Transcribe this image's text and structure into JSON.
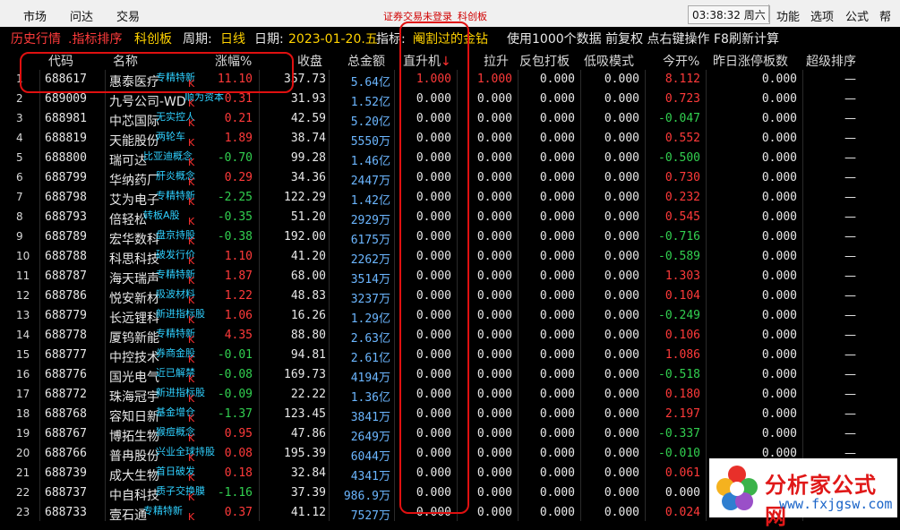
{
  "menubar": {
    "items": [
      "市场",
      "问达",
      "交易"
    ],
    "status_text": "证券交易未登录",
    "status_board": "科创板",
    "time": "03:38:32 周六",
    "right_items": [
      "功能",
      "选项",
      "公式",
      "帮助"
    ]
  },
  "titlebar": {
    "history": "历史行情",
    "ranking": ".指标排序",
    "board": "科创板",
    "period_label": "周期:",
    "period": "日线",
    "date_label": "日期:",
    "date": "2023-01-20.五",
    "indicator_label": "指标:",
    "indicator": "阉割过的金钻",
    "hint": "使用1000个数据 前复权 点右键操作 F8刷新计算"
  },
  "headers": {
    "code": "代码",
    "name": "名称",
    "zf": "涨幅%",
    "sp": "收盘",
    "zje": "总金额",
    "zsj": "直升机",
    "arrow": "↓",
    "ls": "拉升",
    "fbdb": "反包打板",
    "dxms": "低吸模式",
    "jk": "今开%",
    "zrztbs": "昨日涨停板数",
    "cjpx": "超级排序"
  },
  "rows": [
    {
      "idx": "1",
      "code": "688617",
      "name": "惠泰医疗",
      "tag": "专精特新",
      "zf": "11.10",
      "zfc": "red",
      "sp": "357.73",
      "zje": "5.64亿",
      "zsj": "1.000",
      "zsjc": "red",
      "ls": "1.000",
      "lsc": "red",
      "fbdb": "0.000",
      "dxms": "0.000",
      "jk": "8.112",
      "jkc": "red",
      "zr": "0.000",
      "cj": "—"
    },
    {
      "idx": "2",
      "code": "689009",
      "name": "九号公司-WD",
      "tag": "顺为资本",
      "zf": "0.31",
      "zfc": "red",
      "sp": "31.93",
      "zje": "1.52亿",
      "zsj": "0.000",
      "zsjc": "white",
      "ls": "0.000",
      "lsc": "white",
      "fbdb": "0.000",
      "dxms": "0.000",
      "jk": "0.723",
      "jkc": "red",
      "zr": "0.000",
      "cj": "—"
    },
    {
      "idx": "3",
      "code": "688981",
      "name": "中芯国际",
      "tag": "无实控人",
      "zf": "0.21",
      "zfc": "red",
      "sp": "42.59",
      "zje": "5.20亿",
      "zsj": "0.000",
      "zsjc": "white",
      "ls": "0.000",
      "lsc": "white",
      "fbdb": "0.000",
      "dxms": "0.000",
      "jk": "-0.047",
      "jkc": "green",
      "zr": "0.000",
      "cj": "—"
    },
    {
      "idx": "4",
      "code": "688819",
      "name": "天能股份",
      "tag": "两轮车",
      "zf": "1.89",
      "zfc": "red",
      "sp": "38.74",
      "zje": "5550万",
      "zsj": "0.000",
      "zsjc": "white",
      "ls": "0.000",
      "lsc": "white",
      "fbdb": "0.000",
      "dxms": "0.000",
      "jk": "0.552",
      "jkc": "red",
      "zr": "0.000",
      "cj": "—"
    },
    {
      "idx": "5",
      "code": "688800",
      "name": "瑞可达",
      "tag": "比亚迪概念",
      "zf": "-0.70",
      "zfc": "green",
      "sp": "99.28",
      "zje": "1.46亿",
      "zsj": "0.000",
      "zsjc": "white",
      "ls": "0.000",
      "lsc": "white",
      "fbdb": "0.000",
      "dxms": "0.000",
      "jk": "-0.500",
      "jkc": "green",
      "zr": "0.000",
      "cj": "—"
    },
    {
      "idx": "6",
      "code": "688799",
      "name": "华纳药厂",
      "tag": "肝炎概念",
      "zf": "0.29",
      "zfc": "red",
      "sp": "34.36",
      "zje": "2447万",
      "zsj": "0.000",
      "zsjc": "white",
      "ls": "0.000",
      "lsc": "white",
      "fbdb": "0.000",
      "dxms": "0.000",
      "jk": "0.730",
      "jkc": "red",
      "zr": "0.000",
      "cj": "—"
    },
    {
      "idx": "7",
      "code": "688798",
      "name": "艾为电子",
      "tag": "专精特新",
      "zf": "-2.25",
      "zfc": "green",
      "sp": "122.29",
      "zje": "1.42亿",
      "zsj": "0.000",
      "zsjc": "white",
      "ls": "0.000",
      "lsc": "white",
      "fbdb": "0.000",
      "dxms": "0.000",
      "jk": "0.232",
      "jkc": "red",
      "zr": "0.000",
      "cj": "—"
    },
    {
      "idx": "8",
      "code": "688793",
      "name": "倍轻松",
      "tag": "转板A股",
      "zf": "-0.35",
      "zfc": "green",
      "sp": "51.20",
      "zje": "2929万",
      "zsj": "0.000",
      "zsjc": "white",
      "ls": "0.000",
      "lsc": "white",
      "fbdb": "0.000",
      "dxms": "0.000",
      "jk": "0.545",
      "jkc": "red",
      "zr": "0.000",
      "cj": "—"
    },
    {
      "idx": "9",
      "code": "688789",
      "name": "宏华数科",
      "tag": "盘京持股",
      "zf": "-0.38",
      "zfc": "green",
      "sp": "192.00",
      "zje": "6175万",
      "zsj": "0.000",
      "zsjc": "white",
      "ls": "0.000",
      "lsc": "white",
      "fbdb": "0.000",
      "dxms": "0.000",
      "jk": "-0.716",
      "jkc": "green",
      "zr": "0.000",
      "cj": "—"
    },
    {
      "idx": "10",
      "code": "688788",
      "name": "科思科技",
      "tag": "破发行价",
      "zf": "1.10",
      "zfc": "red",
      "sp": "41.20",
      "zje": "2262万",
      "zsj": "0.000",
      "zsjc": "white",
      "ls": "0.000",
      "lsc": "white",
      "fbdb": "0.000",
      "dxms": "0.000",
      "jk": "-0.589",
      "jkc": "green",
      "zr": "0.000",
      "cj": "—"
    },
    {
      "idx": "11",
      "code": "688787",
      "name": "海天瑞声",
      "tag": "专精特新",
      "zf": "1.87",
      "zfc": "red",
      "sp": "68.00",
      "zje": "3514万",
      "zsj": "0.000",
      "zsjc": "white",
      "ls": "0.000",
      "lsc": "white",
      "fbdb": "0.000",
      "dxms": "0.000",
      "jk": "1.303",
      "jkc": "red",
      "zr": "0.000",
      "cj": "—"
    },
    {
      "idx": "12",
      "code": "688786",
      "name": "悦安新材",
      "tag": "吸波材料",
      "zf": "1.22",
      "zfc": "red",
      "sp": "48.83",
      "zje": "3237万",
      "zsj": "0.000",
      "zsjc": "white",
      "ls": "0.000",
      "lsc": "white",
      "fbdb": "0.000",
      "dxms": "0.000",
      "jk": "0.104",
      "jkc": "red",
      "zr": "0.000",
      "cj": "—"
    },
    {
      "idx": "13",
      "code": "688779",
      "name": "长远锂科",
      "tag": "新进指标股",
      "zf": "1.06",
      "zfc": "red",
      "sp": "16.26",
      "zje": "1.29亿",
      "zsj": "0.000",
      "zsjc": "white",
      "ls": "0.000",
      "lsc": "white",
      "fbdb": "0.000",
      "dxms": "0.000",
      "jk": "-0.249",
      "jkc": "green",
      "zr": "0.000",
      "cj": "—"
    },
    {
      "idx": "14",
      "code": "688778",
      "name": "厦钨新能",
      "tag": "专精特新",
      "zf": "4.35",
      "zfc": "red",
      "sp": "88.80",
      "zje": "2.63亿",
      "zsj": "0.000",
      "zsjc": "white",
      "ls": "0.000",
      "lsc": "white",
      "fbdb": "0.000",
      "dxms": "0.000",
      "jk": "0.106",
      "jkc": "red",
      "zr": "0.000",
      "cj": "—"
    },
    {
      "idx": "15",
      "code": "688777",
      "name": "中控技术",
      "tag": "券商金股",
      "zf": "-0.01",
      "zfc": "green",
      "sp": "94.81",
      "zje": "2.61亿",
      "zsj": "0.000",
      "zsjc": "white",
      "ls": "0.000",
      "lsc": "white",
      "fbdb": "0.000",
      "dxms": "0.000",
      "jk": "1.086",
      "jkc": "red",
      "zr": "0.000",
      "cj": "—"
    },
    {
      "idx": "16",
      "code": "688776",
      "name": "国光电气",
      "tag": "近已解禁",
      "zf": "-0.08",
      "zfc": "green",
      "sp": "169.73",
      "zje": "4194万",
      "zsj": "0.000",
      "zsjc": "white",
      "ls": "0.000",
      "lsc": "white",
      "fbdb": "0.000",
      "dxms": "0.000",
      "jk": "-0.518",
      "jkc": "green",
      "zr": "0.000",
      "cj": "—"
    },
    {
      "idx": "17",
      "code": "688772",
      "name": "珠海冠宇",
      "tag": "新进指标股",
      "zf": "-0.09",
      "zfc": "green",
      "sp": "22.22",
      "zje": "1.36亿",
      "zsj": "0.000",
      "zsjc": "white",
      "ls": "0.000",
      "lsc": "white",
      "fbdb": "0.000",
      "dxms": "0.000",
      "jk": "0.180",
      "jkc": "red",
      "zr": "0.000",
      "cj": "—"
    },
    {
      "idx": "18",
      "code": "688768",
      "name": "容知日新",
      "tag": "基金增仓",
      "zf": "-1.37",
      "zfc": "green",
      "sp": "123.45",
      "zje": "3841万",
      "zsj": "0.000",
      "zsjc": "white",
      "ls": "0.000",
      "lsc": "white",
      "fbdb": "0.000",
      "dxms": "0.000",
      "jk": "2.197",
      "jkc": "red",
      "zr": "0.000",
      "cj": "—"
    },
    {
      "idx": "19",
      "code": "688767",
      "name": "博拓生物",
      "tag": "猴痘概念",
      "zf": "0.95",
      "zfc": "red",
      "sp": "47.86",
      "zje": "2649万",
      "zsj": "0.000",
      "zsjc": "white",
      "ls": "0.000",
      "lsc": "white",
      "fbdb": "0.000",
      "dxms": "0.000",
      "jk": "-0.337",
      "jkc": "green",
      "zr": "0.000",
      "cj": "—"
    },
    {
      "idx": "20",
      "code": "688766",
      "name": "普冉股份",
      "tag": "兴业全球持股",
      "zf": "0.08",
      "zfc": "red",
      "sp": "195.39",
      "zje": "6044万",
      "zsj": "0.000",
      "zsjc": "white",
      "ls": "0.000",
      "lsc": "white",
      "fbdb": "0.000",
      "dxms": "0.000",
      "jk": "-0.010",
      "jkc": "green",
      "zr": "0.000",
      "cj": "—"
    },
    {
      "idx": "21",
      "code": "688739",
      "name": "成大生物",
      "tag": "首日破发",
      "zf": "0.18",
      "zfc": "red",
      "sp": "32.84",
      "zje": "4341万",
      "zsj": "0.000",
      "zsjc": "white",
      "ls": "0.000",
      "lsc": "white",
      "fbdb": "0.000",
      "dxms": "0.000",
      "jk": "0.061",
      "jkc": "red",
      "zr": "0.000",
      "cj": "—"
    },
    {
      "idx": "22",
      "code": "688737",
      "name": "中自科技",
      "tag": "质子交换膜",
      "zf": "-1.16",
      "zfc": "green",
      "sp": "37.39",
      "zje": "986.9万",
      "zsj": "0.000",
      "zsjc": "white",
      "ls": "0.000",
      "lsc": "white",
      "fbdb": "0.000",
      "dxms": "0.000",
      "jk": "0.000",
      "jkc": "white",
      "zr": "0.000",
      "cj": "—"
    },
    {
      "idx": "23",
      "code": "688733",
      "name": "壹石通",
      "tag": "专精特新",
      "zf": "0.37",
      "zfc": "red",
      "sp": "41.12",
      "zje": "7527万",
      "zsj": "0.000",
      "zsjc": "white",
      "ls": "0.000",
      "lsc": "white",
      "fbdb": "0.000",
      "dxms": "0.000",
      "jk": "0.024",
      "jkc": "red",
      "zr": "0.000",
      "cj": "—"
    }
  ],
  "watermark": {
    "title": "分析家公式网",
    "url": "www.fxjgsw.com"
  },
  "colors": {
    "up": "#ff3a3a",
    "down": "#32d050",
    "tag": "#2fd0ff",
    "amount": "#6bb6ff",
    "annotation": "#e01010"
  }
}
